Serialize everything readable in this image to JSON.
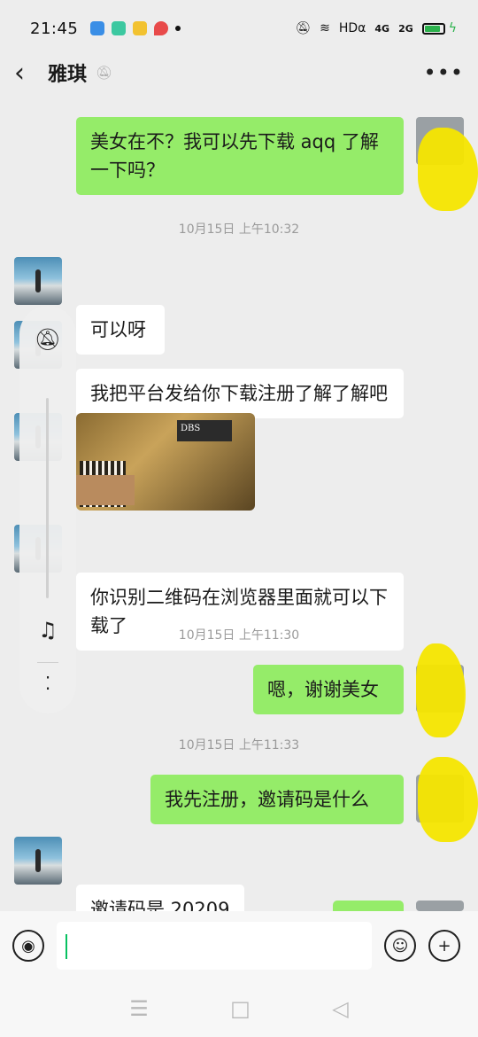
{
  "status_bar": {
    "time": "21:45",
    "network": "HDα",
    "signal_1": "4G",
    "signal_2": "2G",
    "battery_color": "#2bb24c"
  },
  "header": {
    "title": "雅琪",
    "more_glyph": "•••"
  },
  "messages": [
    {
      "type": "text",
      "side": "out",
      "text": "美女在不？我可以先下载 aqq 了解一下吗？"
    },
    {
      "type": "time",
      "text": "10月15日 上午10:32"
    },
    {
      "type": "text",
      "side": "in",
      "text": "可以呀"
    },
    {
      "type": "text",
      "side": "in",
      "text": "我把平台发给你下载注册了解了解吧"
    },
    {
      "type": "image",
      "side": "in",
      "caption": "DBS"
    },
    {
      "type": "text",
      "side": "in",
      "text": "你识别二维码在浏览器里面就可以下载了"
    },
    {
      "type": "time",
      "text": "10月15日 上午11:30"
    },
    {
      "type": "text",
      "side": "out",
      "text": "嗯，谢谢美女"
    },
    {
      "type": "time",
      "text": "10月15日 上午11:33"
    },
    {
      "type": "text",
      "side": "out",
      "text": "我先注册，邀请码是什么"
    },
    {
      "type": "text",
      "side": "in",
      "text": "邀请码是 20209"
    }
  ],
  "floating_panel": {
    "icons": [
      "bell-off-icon",
      "music-off-icon",
      "more-vertical-icon"
    ]
  },
  "input": {
    "value": ""
  },
  "colors": {
    "bubble_out": "#95ec69",
    "bubble_in": "#ffffff",
    "background": "#ededed"
  }
}
